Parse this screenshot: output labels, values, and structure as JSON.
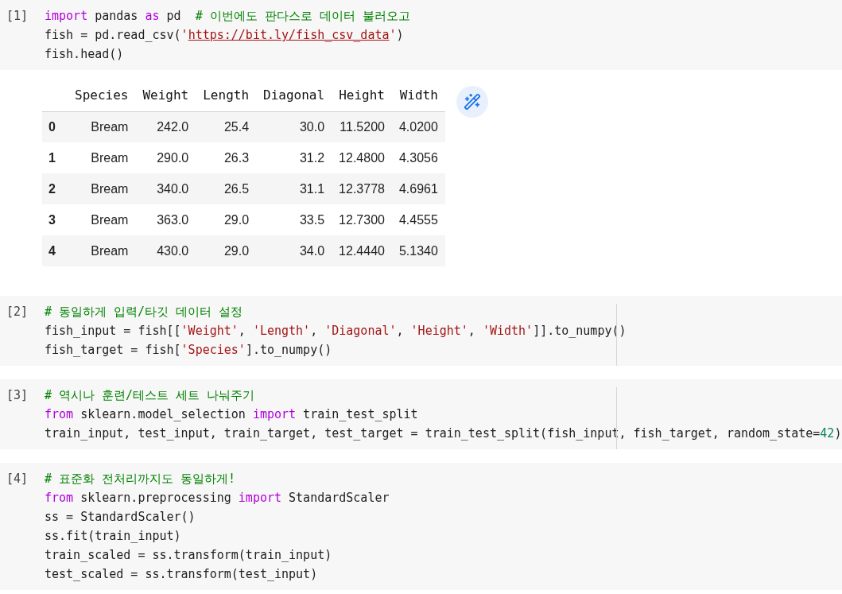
{
  "cells": [
    {
      "prompt": "[1]",
      "ruler": false,
      "lines": [
        [
          {
            "kind": "keyword",
            "text": "import"
          },
          {
            "kind": "plain",
            "text": " pandas "
          },
          {
            "kind": "keyword",
            "text": "as"
          },
          {
            "kind": "plain",
            "text": " pd  "
          },
          {
            "kind": "comment",
            "text": "# 이번에도 판다스로 데이터 불러오고"
          }
        ],
        [
          {
            "kind": "plain",
            "text": "fish = pd.read_csv("
          },
          {
            "kind": "string",
            "text": "'"
          },
          {
            "kind": "link",
            "text": "https://bit.ly/fish_csv_data"
          },
          {
            "kind": "string",
            "text": "'"
          },
          {
            "kind": "plain",
            "text": ")"
          }
        ],
        [
          {
            "kind": "plain",
            "text": "fish.head()"
          }
        ]
      ],
      "output": {
        "columns": [
          "Species",
          "Weight",
          "Length",
          "Diagonal",
          "Height",
          "Width"
        ],
        "rows": [
          {
            "index": "0",
            "cells": [
              "Bream",
              "242.0",
              "25.4",
              "30.0",
              "11.5200",
              "4.0200"
            ]
          },
          {
            "index": "1",
            "cells": [
              "Bream",
              "290.0",
              "26.3",
              "31.2",
              "12.4800",
              "4.3056"
            ]
          },
          {
            "index": "2",
            "cells": [
              "Bream",
              "340.0",
              "26.5",
              "31.1",
              "12.3778",
              "4.6961"
            ]
          },
          {
            "index": "3",
            "cells": [
              "Bream",
              "363.0",
              "29.0",
              "33.5",
              "12.7300",
              "4.4555"
            ]
          },
          {
            "index": "4",
            "cells": [
              "Bream",
              "430.0",
              "29.0",
              "34.0",
              "12.4440",
              "5.1340"
            ]
          }
        ]
      }
    },
    {
      "prompt": "[2]",
      "ruler": true,
      "lines": [
        [
          {
            "kind": "comment",
            "text": "# 동일하게 입력/타깃 데이터 설정"
          }
        ],
        [
          {
            "kind": "plain",
            "text": "fish_input = fish[["
          },
          {
            "kind": "string",
            "text": "'Weight'"
          },
          {
            "kind": "plain",
            "text": ", "
          },
          {
            "kind": "string",
            "text": "'Length'"
          },
          {
            "kind": "plain",
            "text": ", "
          },
          {
            "kind": "string",
            "text": "'Diagonal'"
          },
          {
            "kind": "plain",
            "text": ", "
          },
          {
            "kind": "string",
            "text": "'Height'"
          },
          {
            "kind": "plain",
            "text": ", "
          },
          {
            "kind": "string",
            "text": "'Width'"
          },
          {
            "kind": "plain",
            "text": "]].to_numpy()"
          }
        ],
        [
          {
            "kind": "plain",
            "text": "fish_target = fish["
          },
          {
            "kind": "string",
            "text": "'Species'"
          },
          {
            "kind": "plain",
            "text": "].to_numpy()"
          }
        ]
      ]
    },
    {
      "prompt": "[3]",
      "ruler": true,
      "lines": [
        [
          {
            "kind": "comment",
            "text": "# 역시나 훈련/테스트 세트 나눠주기"
          }
        ],
        [
          {
            "kind": "keyword",
            "text": "from"
          },
          {
            "kind": "plain",
            "text": " sklearn.model_selection "
          },
          {
            "kind": "keyword",
            "text": "import"
          },
          {
            "kind": "plain",
            "text": " train_test_split"
          }
        ],
        [
          {
            "kind": "plain",
            "text": "train_input, test_input, train_target, test_target = train_test_split(fish_input, fish_target, random_state="
          },
          {
            "kind": "number",
            "text": "42"
          },
          {
            "kind": "plain",
            "text": ")"
          }
        ]
      ]
    },
    {
      "prompt": "[4]",
      "ruler": false,
      "lines": [
        [
          {
            "kind": "comment",
            "text": "# 표준화 전처리까지도 동일하게!"
          }
        ],
        [
          {
            "kind": "keyword",
            "text": "from"
          },
          {
            "kind": "plain",
            "text": " sklearn.preprocessing "
          },
          {
            "kind": "keyword",
            "text": "import"
          },
          {
            "kind": "plain",
            "text": " StandardScaler"
          }
        ],
        [
          {
            "kind": "plain",
            "text": "ss = StandardScaler()"
          }
        ],
        [
          {
            "kind": "plain",
            "text": "ss.fit(train_input)"
          }
        ],
        [
          {
            "kind": "plain",
            "text": "train_scaled = ss.transform(train_input)"
          }
        ],
        [
          {
            "kind": "plain",
            "text": "test_scaled = ss.transform(test_input)"
          }
        ]
      ]
    }
  ]
}
